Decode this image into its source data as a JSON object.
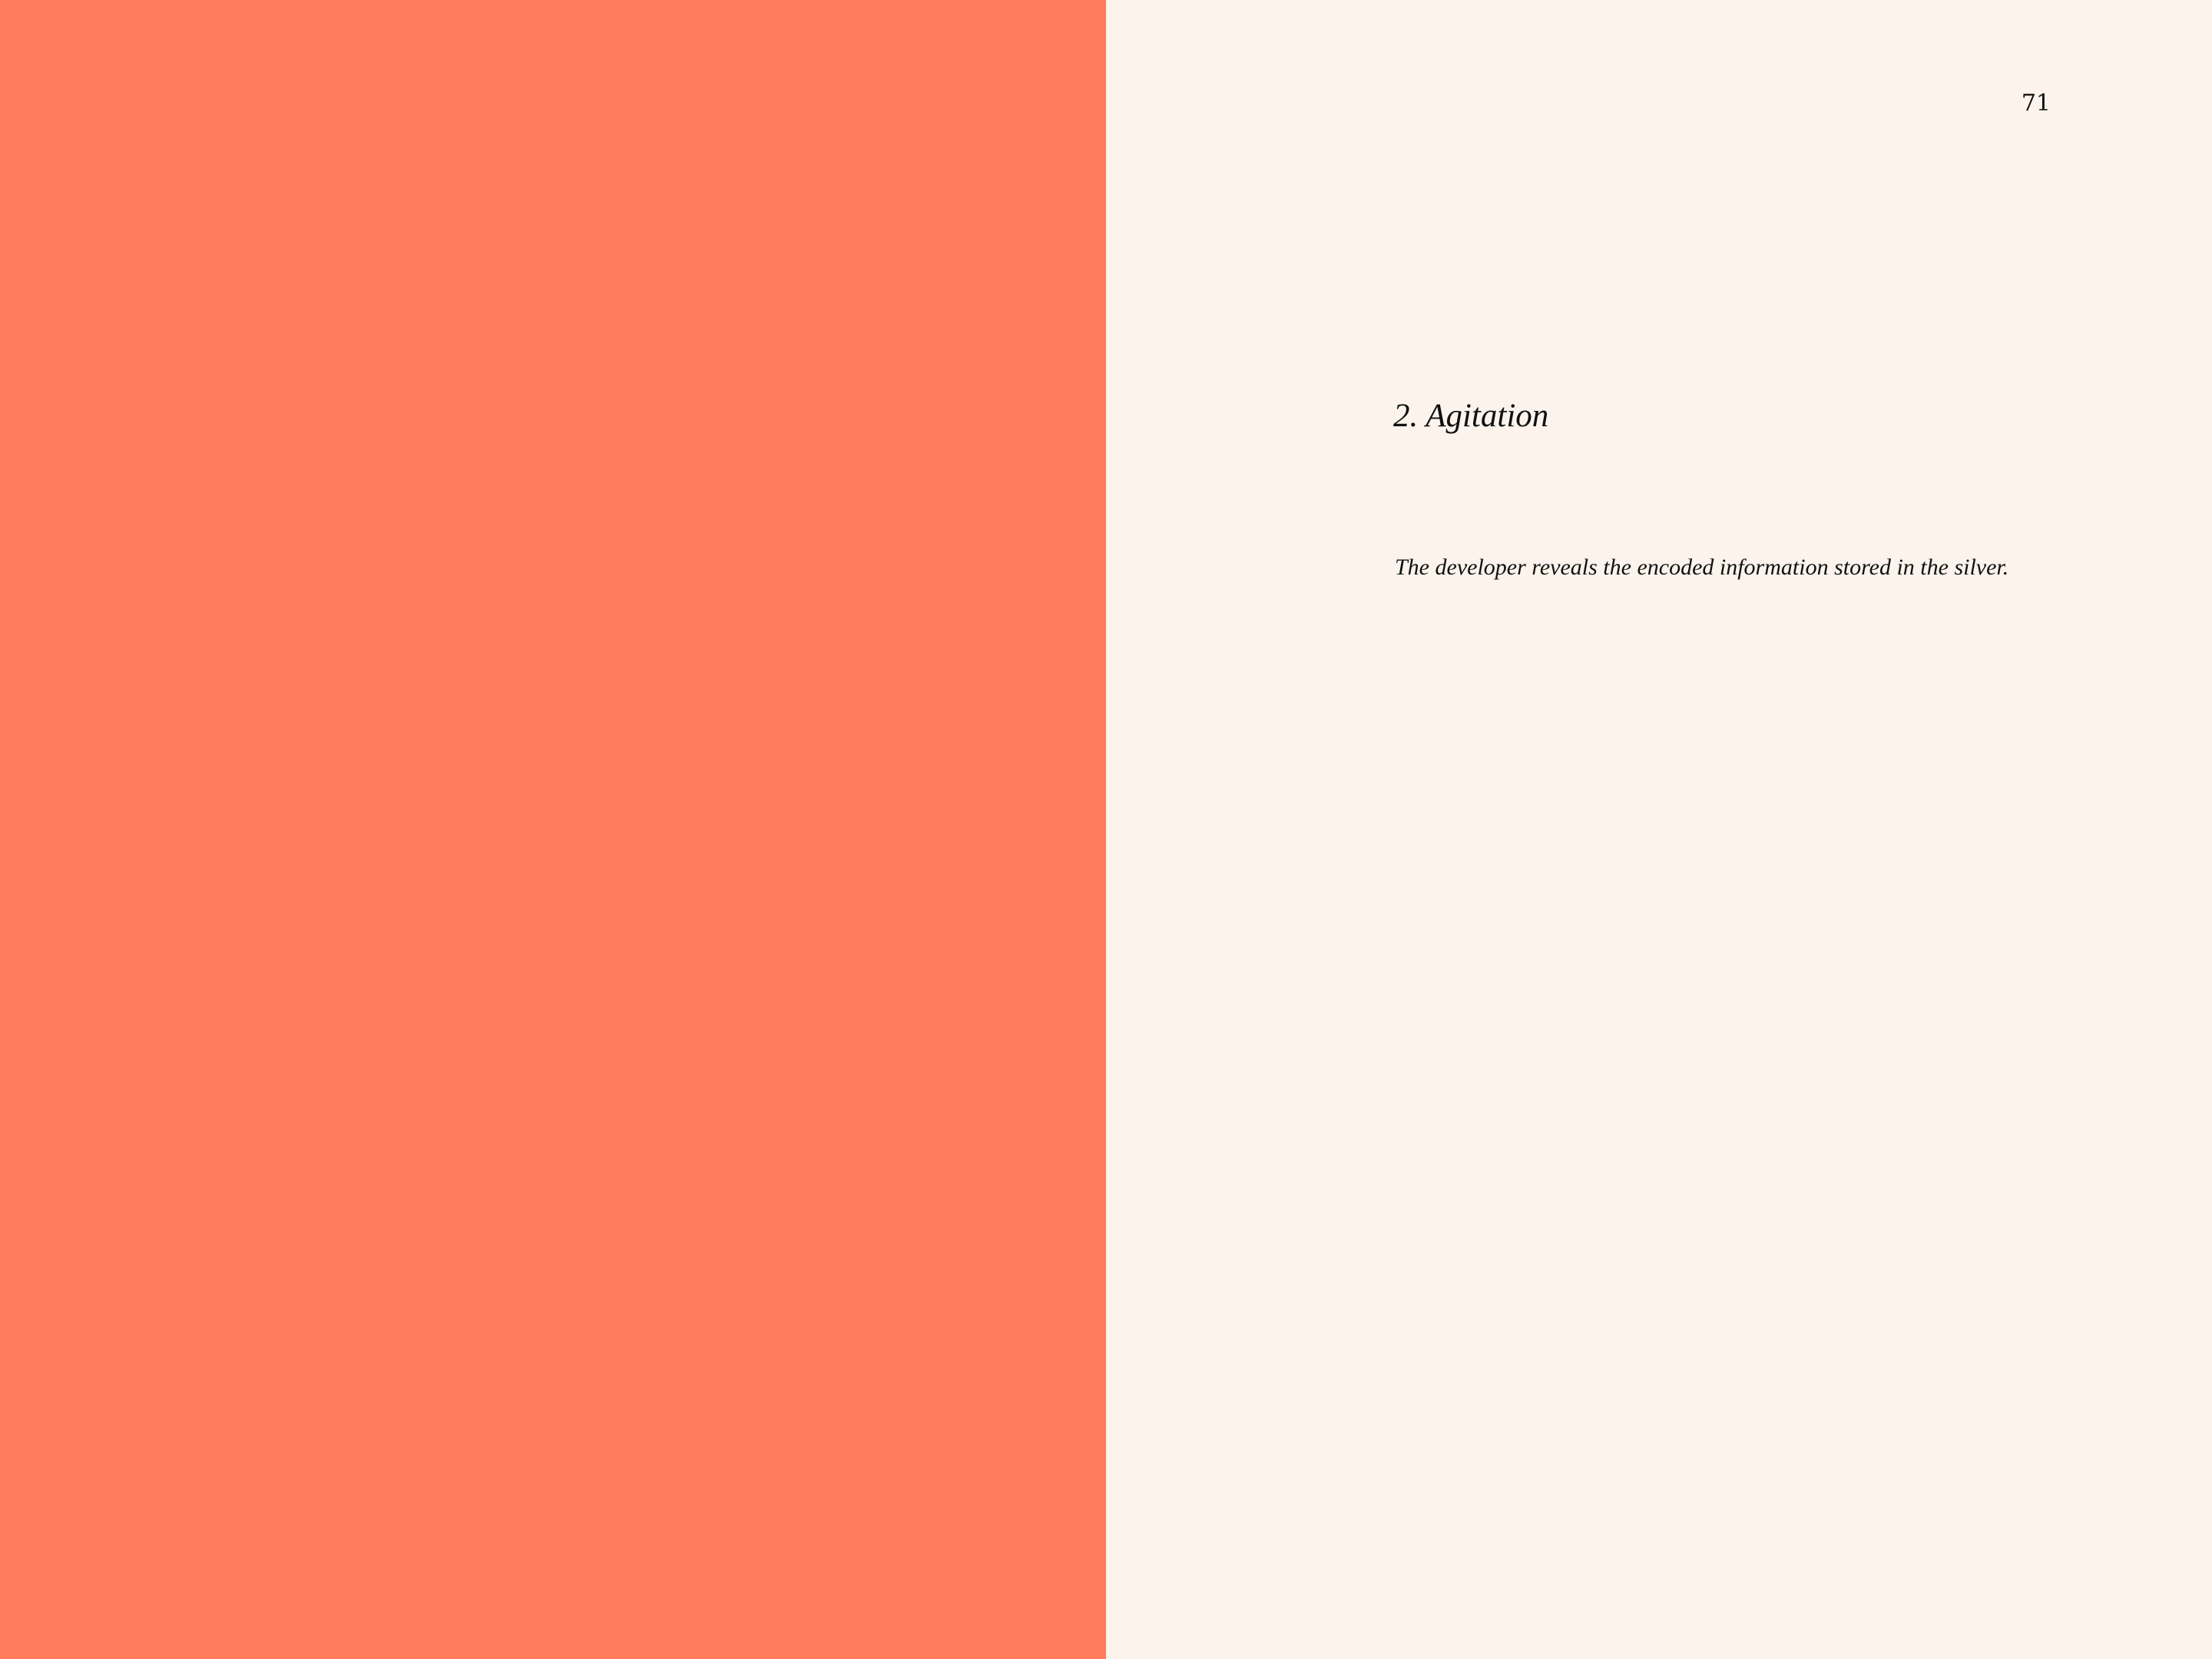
{
  "document": {
    "page_number": "71",
    "chapter_title": "2. Agitation",
    "body_text": "The developer reveals the encoded information stored in the silver."
  },
  "colors": {
    "left_page": "#ff7b5e",
    "right_page": "#fbf3ec",
    "text": "#111111"
  }
}
